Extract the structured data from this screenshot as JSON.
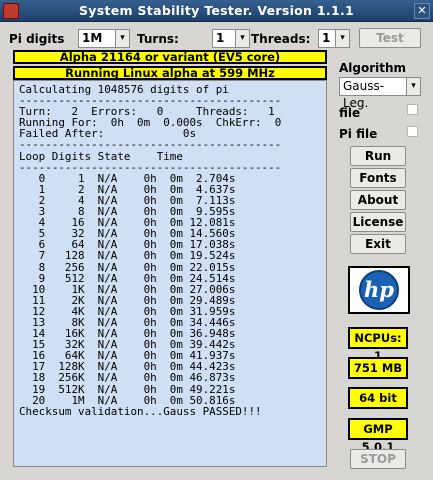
{
  "window": {
    "title": "System Stability Tester. Version 1.1.1",
    "close_glyph": "✕"
  },
  "toolbar": {
    "pi_digits_label": "Pi digits",
    "pi_digits_value": "1M",
    "turns_label": "Turns:",
    "turns_value": "1",
    "threads_label": "Threads:",
    "threads_value": "1",
    "arrow": "▾",
    "test_button": "Test"
  },
  "banners": {
    "cpu": "Alpha 21164 or variant (EV5 core)",
    "os": "Running Linux alpha at 599 MHz"
  },
  "console": {
    "header": "Calculating 1048576 digits of pi",
    "separator": "----------------------------------------",
    "status_line1": "Turn:   2  Errors:   0     Threads:   1",
    "status_line2": "Running For:  0h  0m  0.000s  ChkErr:  0",
    "status_line3": "Failed After:            0s",
    "table_header": "Loop Digits State    Time",
    "rows": [
      "   0     1  N/A    0h  0m  2.704s",
      "   1     2  N/A    0h  0m  4.637s",
      "   2     4  N/A    0h  0m  7.113s",
      "   3     8  N/A    0h  0m  9.595s",
      "   4    16  N/A    0h  0m 12.081s",
      "   5    32  N/A    0h  0m 14.560s",
      "   6    64  N/A    0h  0m 17.038s",
      "   7   128  N/A    0h  0m 19.524s",
      "   8   256  N/A    0h  0m 22.015s",
      "   9   512  N/A    0h  0m 24.514s",
      "  10    1K  N/A    0h  0m 27.006s",
      "  11    2K  N/A    0h  0m 29.489s",
      "  12    4K  N/A    0h  0m 31.959s",
      "  13    8K  N/A    0h  0m 34.446s",
      "  14   16K  N/A    0h  0m 36.948s",
      "  15   32K  N/A    0h  0m 39.442s",
      "  16   64K  N/A    0h  0m 41.937s",
      "  17  128K  N/A    0h  0m 44.423s",
      "  18  256K  N/A    0h  0m 46.873s",
      "  19  512K  N/A    0h  0m 49.221s",
      "  20    1M  N/A    0h  0m 50.816s"
    ],
    "footer": "Checksum validation...Gauss PASSED!!!"
  },
  "sidebar": {
    "algorithm_label": "Algorithm",
    "algorithm_value": "Gauss-Leg.",
    "file_label": "file",
    "pi_file_label": "Pi file",
    "buttons": {
      "run": "Run",
      "fonts": "Fonts",
      "about": "About",
      "license": "License",
      "exit": "Exit",
      "stop": "STOP"
    },
    "logo_text": "hp",
    "info": {
      "ncpus": "NCPUs: 1",
      "memory": "751 MB",
      "bits": "64 bit",
      "gmp": "GMP 5.0.1"
    }
  }
}
